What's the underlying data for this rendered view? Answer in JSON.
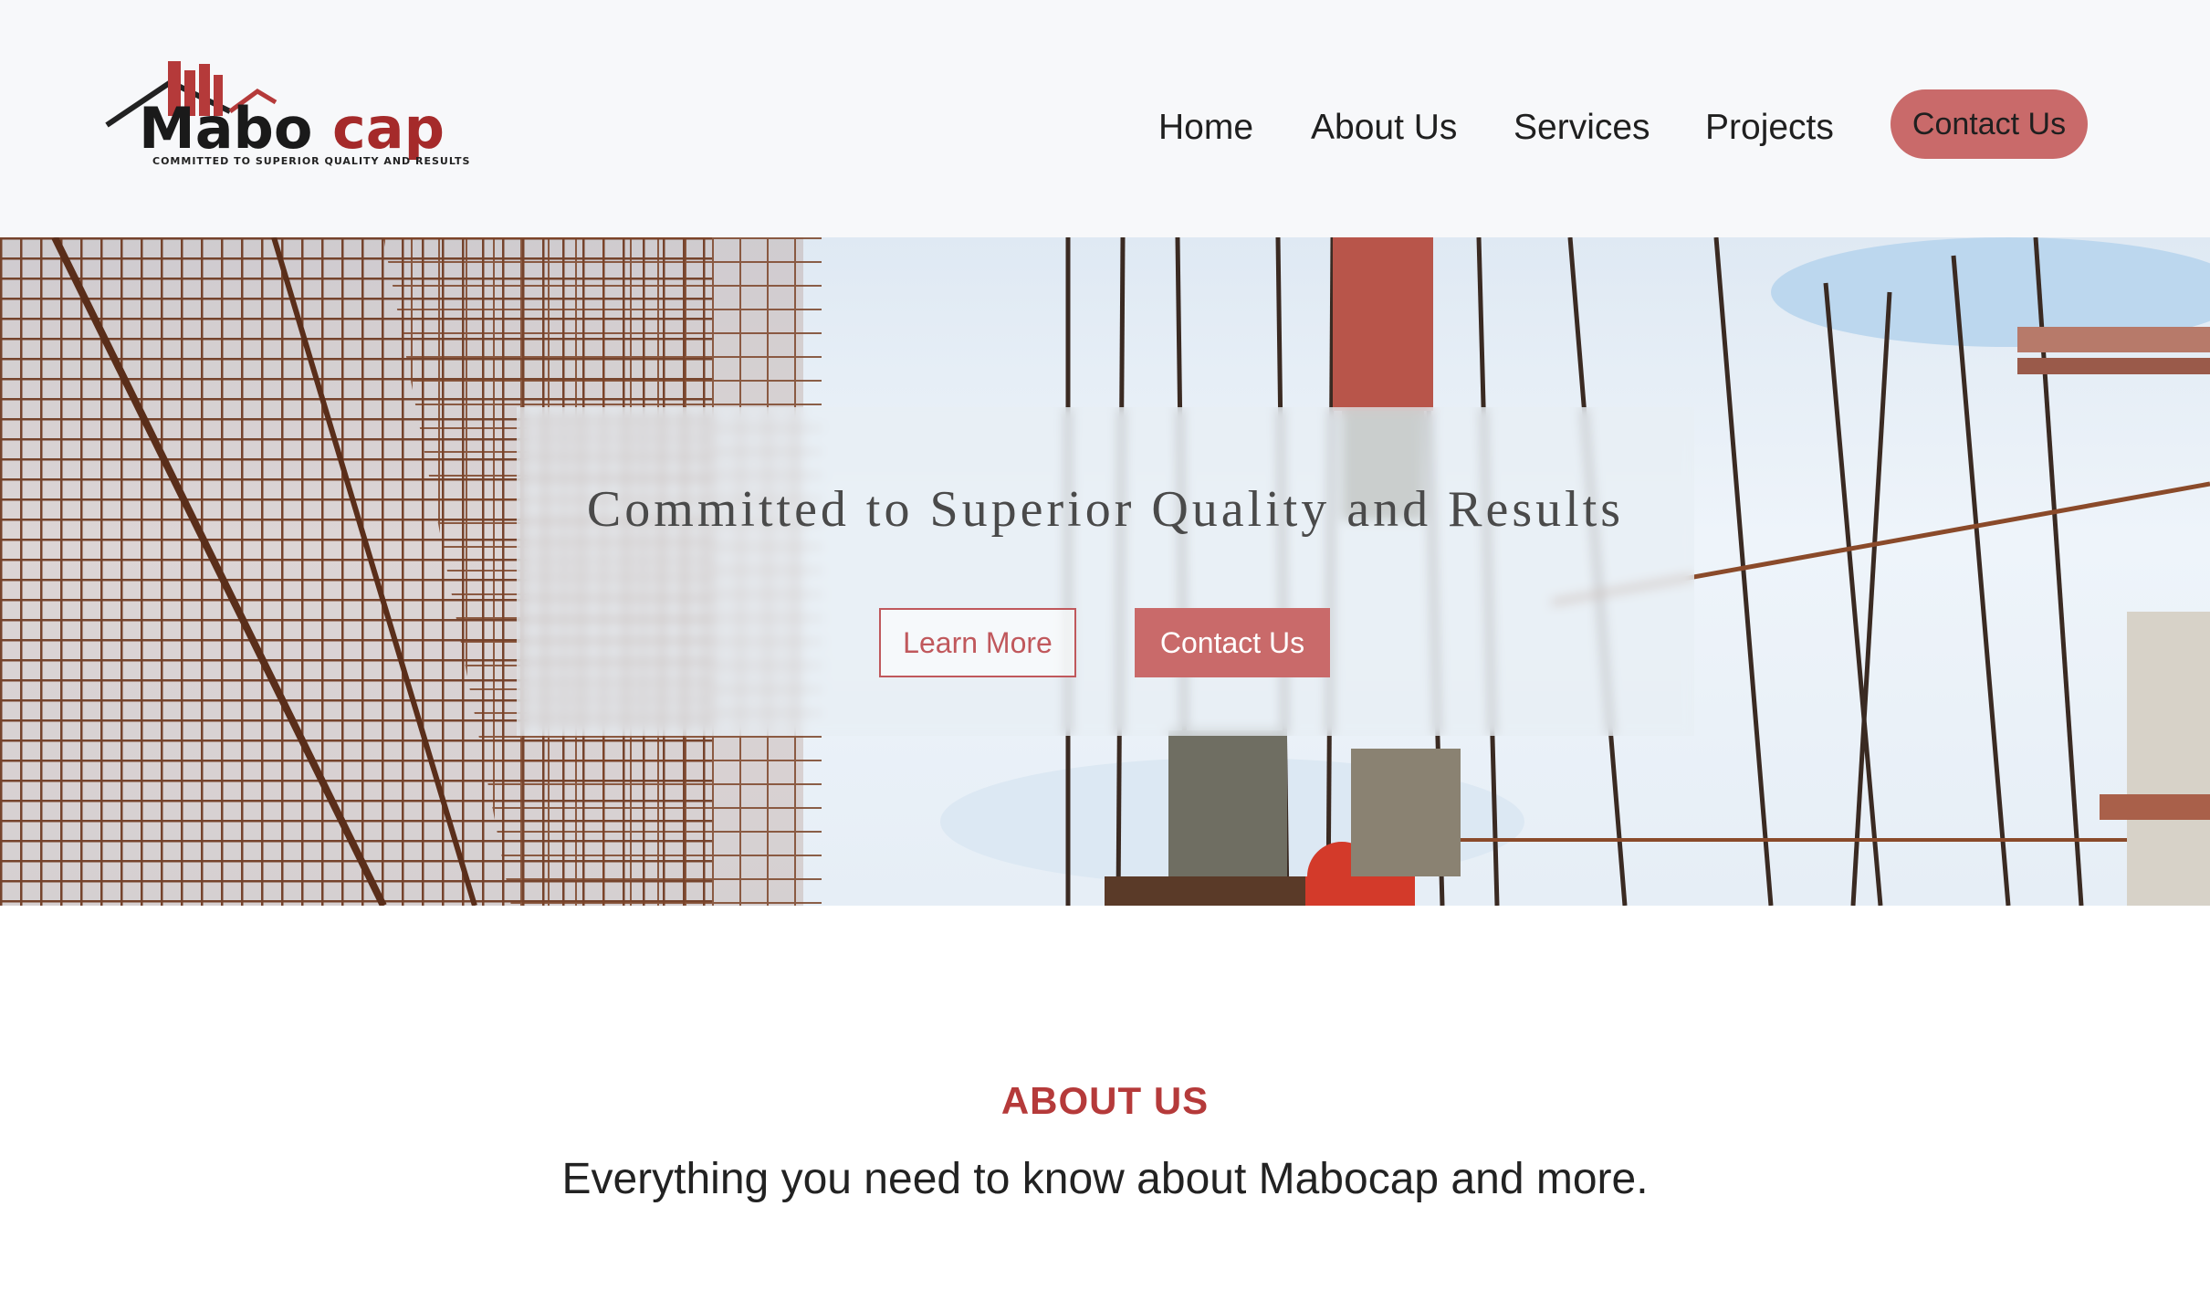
{
  "brand": {
    "name_part1": "Mabo",
    "name_part2": "cap",
    "tagline": "COMMITTED TO SUPERIOR QUALITY AND RESULTS"
  },
  "nav": {
    "items": [
      {
        "label": "Home"
      },
      {
        "label": "About Us"
      },
      {
        "label": "Services"
      },
      {
        "label": "Projects"
      }
    ],
    "contact_label": "Contact Us"
  },
  "hero": {
    "title": "Committed to Superior Quality and Results",
    "learn_more_label": "Learn More",
    "contact_label": "Contact Us"
  },
  "about": {
    "heading": "ABOUT US",
    "subheading": "Everything you need to know about Mabocap and more."
  },
  "colors": {
    "accent": "#c96a6a",
    "accent_dark": "#b53a3a",
    "header_bg": "#f7f8fa"
  }
}
